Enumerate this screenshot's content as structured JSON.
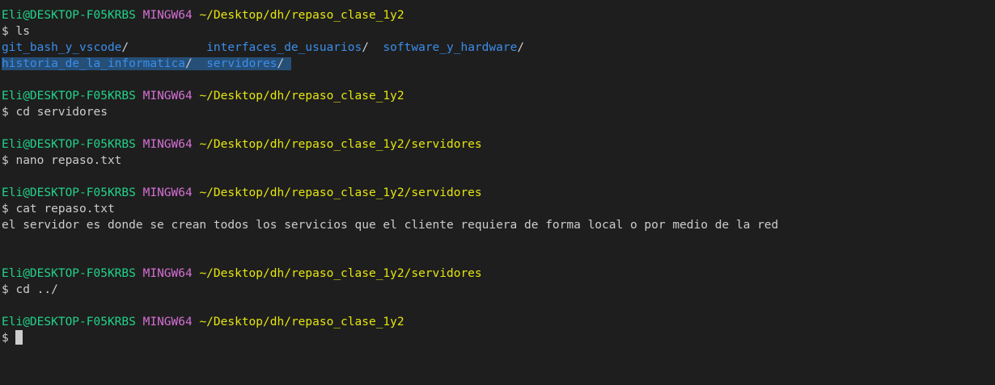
{
  "prompt": {
    "user": "Eli@DESKTOP-F05KRBS",
    "shell": "MINGW64",
    "symbol": "$"
  },
  "colors": {
    "user": "#23d18b",
    "shell": "#d670d6",
    "path": "#e5e510",
    "directory": "#3b8eea",
    "text": "#cccccc",
    "background": "#1e1e1e",
    "selection": "#264f78"
  },
  "blocks": [
    {
      "path": "~/Desktop/dh/repaso_clase_1y2",
      "command": "ls",
      "ls_rows": [
        [
          {
            "name": "git_bash_y_vscode",
            "pad": "           "
          },
          {
            "name": "interfaces_de_usuarios",
            "pad": "  "
          },
          {
            "name": "software_y_hardware",
            "pad": ""
          }
        ],
        [
          {
            "name": "historia_de_la_informatica",
            "pad": "  "
          },
          {
            "name": "servidores",
            "pad": ""
          }
        ]
      ]
    },
    {
      "path": "~/Desktop/dh/repaso_clase_1y2",
      "command": "cd servidores"
    },
    {
      "path": "~/Desktop/dh/repaso_clase_1y2/servidores",
      "command": "nano repaso.txt"
    },
    {
      "path": "~/Desktop/dh/repaso_clase_1y2/servidores",
      "command": "cat repaso.txt",
      "output": "el servidor es donde se crean todos los servicios que el cliente requiera de forma local o por medio de la red"
    },
    {
      "path": "~/Desktop/dh/repaso_clase_1y2/servidores",
      "command": "cd ../"
    },
    {
      "path": "~/Desktop/dh/repaso_clase_1y2",
      "command": ""
    }
  ]
}
